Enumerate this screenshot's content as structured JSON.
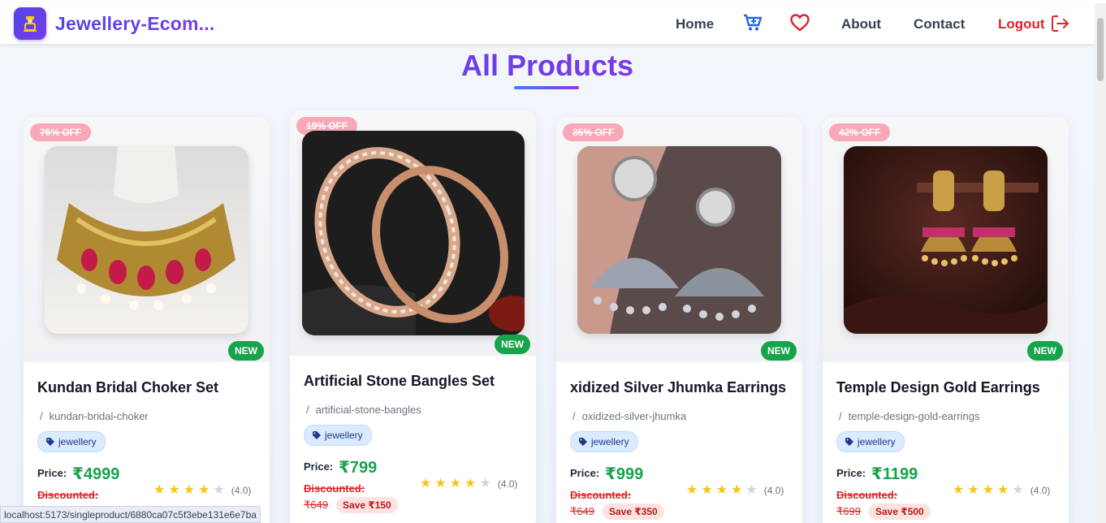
{
  "brand": {
    "name": "Jewellery-Ecom...",
    "logo_icon": "ring-icon"
  },
  "nav": {
    "home": "Home",
    "cart_icon": "cart-icon",
    "wishlist_icon": "heart-icon",
    "about": "About",
    "contact": "Contact",
    "logout": "Logout"
  },
  "page": {
    "title": "All Products"
  },
  "colors": {
    "accent": "#4f46e5",
    "price": "#16a34a",
    "danger": "#dc2626",
    "star": "#f5c518"
  },
  "products": [
    {
      "off": "76% OFF",
      "new": "NEW",
      "name": "Kundan Bridal Choker Set",
      "slug_sep": "/",
      "slug": "kundan-bridal-choker",
      "category": "jewellery",
      "price_label": "Price:",
      "price": "₹4999",
      "discount_label": "Discounted:",
      "old_price": "",
      "save": "",
      "rating": 4,
      "rating_text": "(4.0)"
    },
    {
      "off": "19% OFF",
      "new": "NEW",
      "name": "Artificial Stone Bangles Set",
      "slug_sep": "/",
      "slug": "artificial-stone-bangles",
      "category": "jewellery",
      "price_label": "Price:",
      "price": "₹799",
      "discount_label": "Discounted:",
      "old_price": "₹649",
      "save": "Save ₹150",
      "rating": 4,
      "rating_text": "(4.0)"
    },
    {
      "off": "35% OFF",
      "new": "NEW",
      "name": "xidized Silver Jhumka Earrings",
      "slug_sep": "/",
      "slug": "oxidized-silver-jhumka",
      "category": "jewellery",
      "price_label": "Price:",
      "price": "₹999",
      "discount_label": "Discounted:",
      "old_price": "₹649",
      "save": "Save ₹350",
      "rating": 4,
      "rating_text": "(4.0)"
    },
    {
      "off": "42% OFF",
      "new": "NEW",
      "name": "Temple Design Gold Earrings",
      "slug_sep": "/",
      "slug": "temple-design-gold-earrings",
      "category": "jewellery",
      "price_label": "Price:",
      "price": "₹1199",
      "discount_label": "Discounted:",
      "old_price": "₹699",
      "save": "Save ₹500",
      "rating": 4,
      "rating_text": "(4.0)"
    }
  ],
  "status_url": "localhost:5173/singleproduct/6880ca07c5f3ebe131e6e7ba"
}
